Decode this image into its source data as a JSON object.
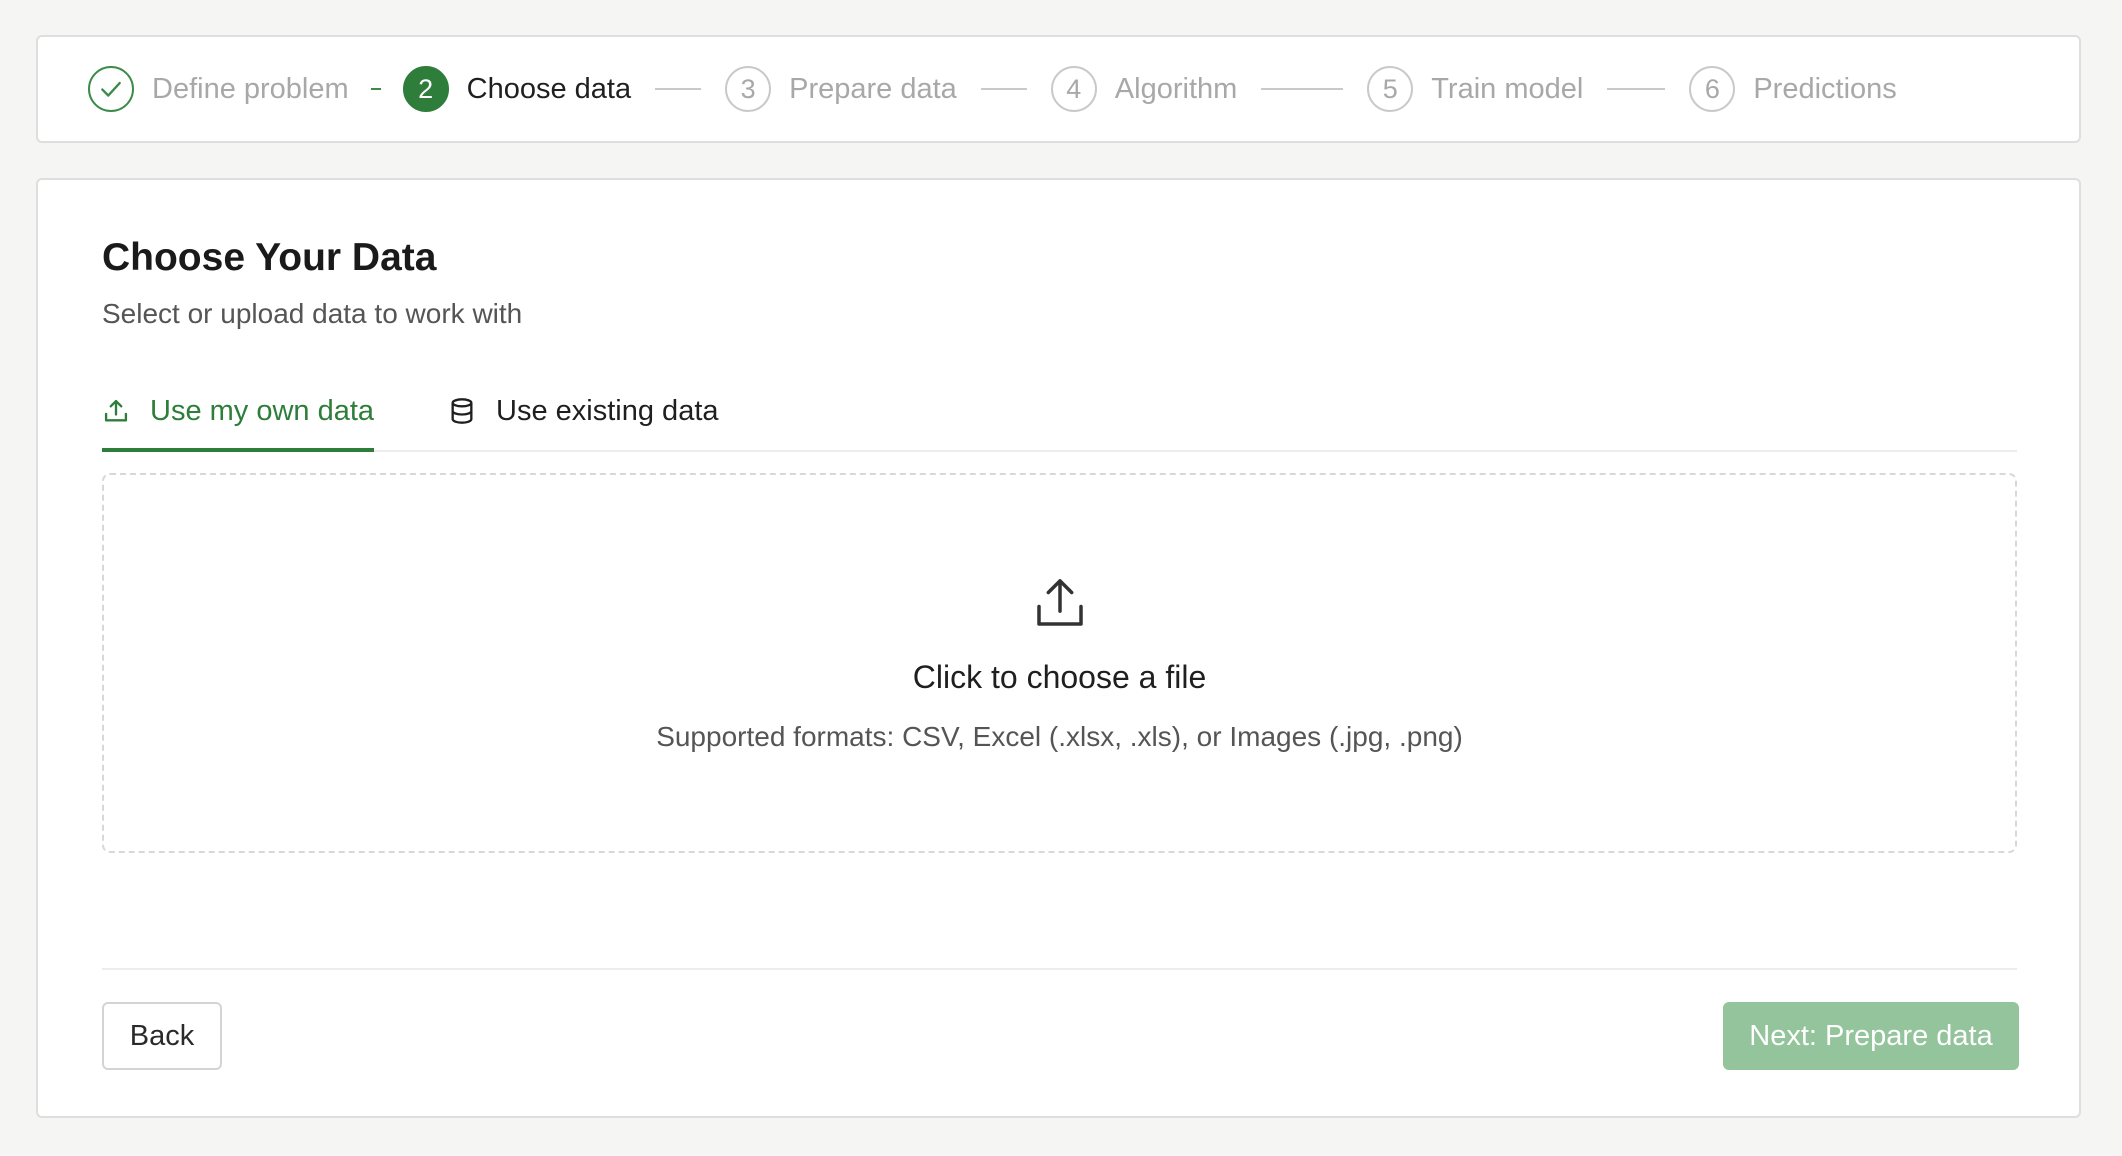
{
  "stepper": {
    "steps": [
      {
        "number": "",
        "label": "Define problem",
        "state": "completed",
        "icon": "checkmark-icon"
      },
      {
        "number": "2",
        "label": "Choose data",
        "state": "current"
      },
      {
        "number": "3",
        "label": "Prepare data",
        "state": "upcoming"
      },
      {
        "number": "4",
        "label": "Algorithm",
        "state": "upcoming"
      },
      {
        "number": "5",
        "label": "Train model",
        "state": "upcoming"
      },
      {
        "number": "6",
        "label": "Predictions",
        "state": "upcoming"
      }
    ]
  },
  "main": {
    "title": "Choose Your Data",
    "subtitle": "Select or upload data to work with",
    "tabs": [
      {
        "label": "Use my own data",
        "icon": "upload-icon",
        "active": true
      },
      {
        "label": "Use existing data",
        "icon": "database-icon",
        "active": false
      }
    ],
    "dropzone": {
      "icon": "upload-icon",
      "title": "Click to choose a file",
      "hint": "Supported formats: CSV, Excel (.xlsx, .xls), or Images (.jpg, .png)"
    }
  },
  "footer": {
    "back_label": "Back",
    "next_label": "Next: Prepare data"
  },
  "colors": {
    "accent": "#2e7d3a",
    "accent_disabled": "#93c49b",
    "muted_text": "#a8a8a8",
    "background": "#f5f5f4"
  }
}
